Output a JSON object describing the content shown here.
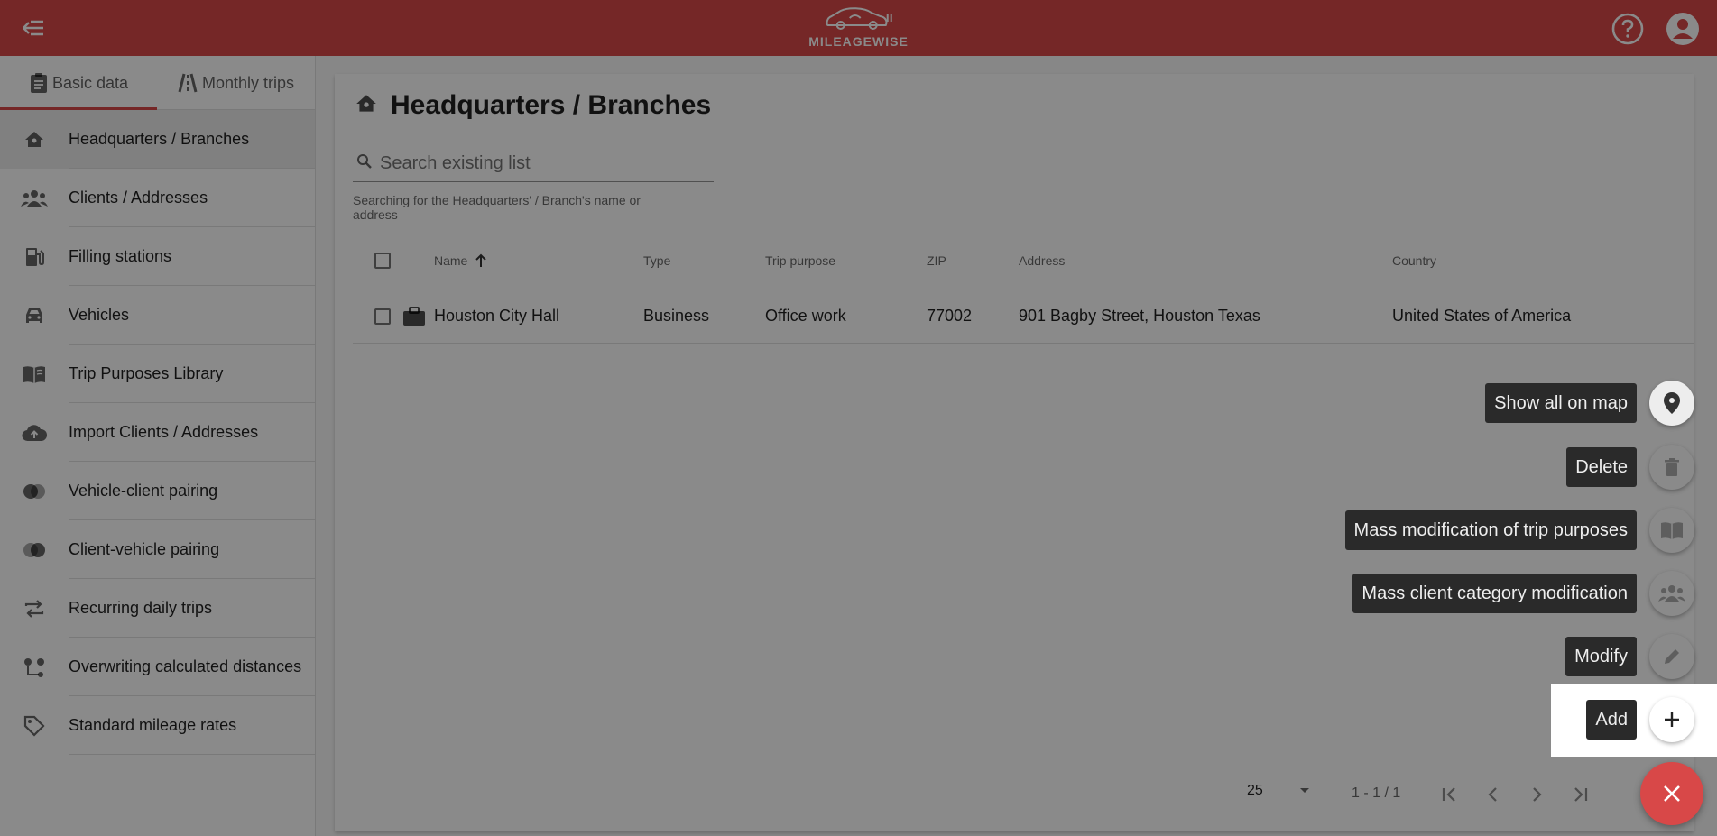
{
  "app": {
    "logo_text": "MILEAGEWISE"
  },
  "sidebar": {
    "tabs": [
      {
        "label": "Basic data"
      },
      {
        "label": "Monthly trips"
      }
    ],
    "items": [
      {
        "label": "Headquarters / Branches",
        "icon": "home-icon"
      },
      {
        "label": "Clients / Addresses",
        "icon": "group-icon"
      },
      {
        "label": "Filling stations",
        "icon": "fuel-icon"
      },
      {
        "label": "Vehicles",
        "icon": "car-icon"
      },
      {
        "label": "Trip Purposes Library",
        "icon": "book-icon"
      },
      {
        "label": "Import Clients / Addresses",
        "icon": "cloud-upload-icon"
      },
      {
        "label": "Vehicle-client pairing",
        "icon": "pairing-icon"
      },
      {
        "label": "Client-vehicle pairing",
        "icon": "pairing-icon"
      },
      {
        "label": "Recurring daily trips",
        "icon": "repeat-icon"
      },
      {
        "label": "Overwriting calculated distances",
        "icon": "route-icon"
      },
      {
        "label": "Standard mileage rates",
        "icon": "tag-icon"
      }
    ]
  },
  "main": {
    "title": "Headquarters / Branches",
    "search": {
      "placeholder": "Search existing list",
      "hint": "Searching for the Headquarters' / Branch's name or address"
    },
    "table": {
      "columns": [
        "Name",
        "Type",
        "Trip purpose",
        "ZIP",
        "Address",
        "Country"
      ],
      "rows": [
        {
          "name": "Houston City Hall",
          "type": "Business",
          "purpose": "Office work",
          "zip": "77002",
          "address": "901 Bagby Street, Houston Texas",
          "country": "United States of America"
        }
      ]
    },
    "paginator": {
      "page_size": "25",
      "range": "1 - 1 / 1"
    }
  },
  "speed_dial": {
    "show_on_map": "Show all on map",
    "delete": "Delete",
    "mass_trip_purposes": "Mass modification of trip purposes",
    "mass_client_category": "Mass client category modification",
    "modify": "Modify",
    "add": "Add"
  },
  "colors": {
    "brand": "#d84848",
    "tooltip": "#2a2a2a"
  }
}
